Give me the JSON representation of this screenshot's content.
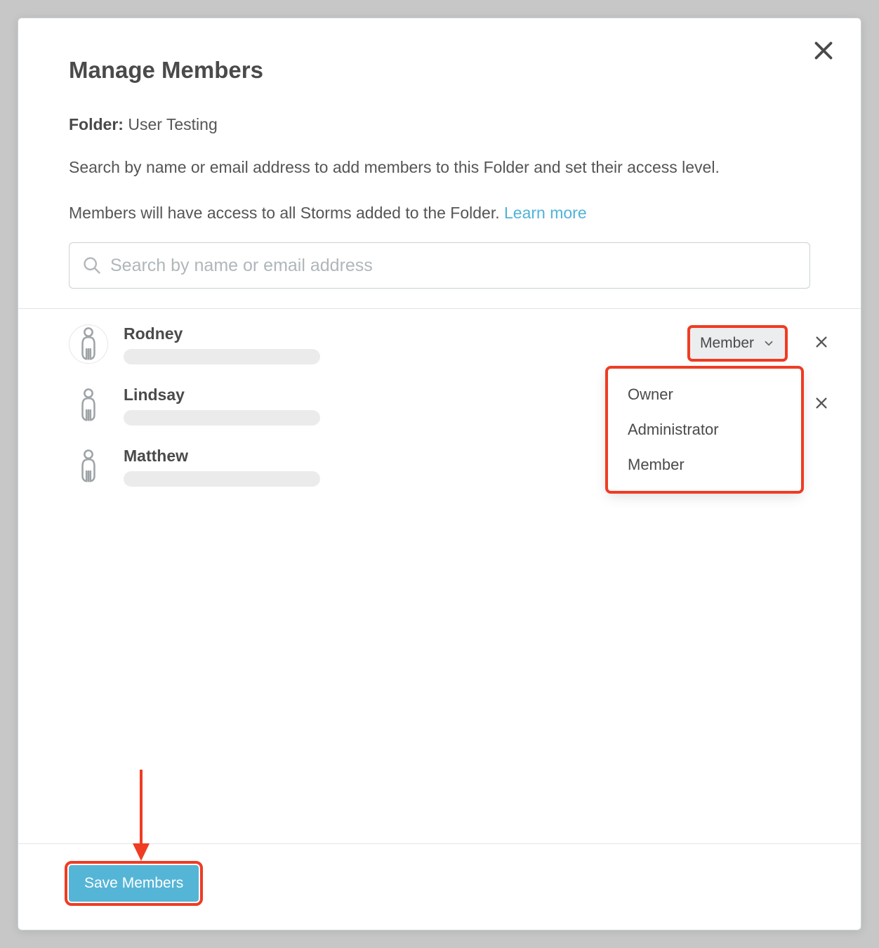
{
  "modal": {
    "title": "Manage Members",
    "folder_label": "Folder:",
    "folder_name": "User Testing",
    "description1": "Search by name or email address to add members to this Folder and set their access level.",
    "description2": "Members will have access to all Storms added to the Folder. ",
    "learn_more": "Learn more",
    "search_placeholder": "Search by name or email address",
    "save_button": "Save Members"
  },
  "members": [
    {
      "name": "Rodney",
      "role": "Member"
    },
    {
      "name": "Lindsay",
      "role": ""
    },
    {
      "name": "Matthew",
      "role": ""
    }
  ],
  "role_options": [
    "Owner",
    "Administrator",
    "Member"
  ]
}
